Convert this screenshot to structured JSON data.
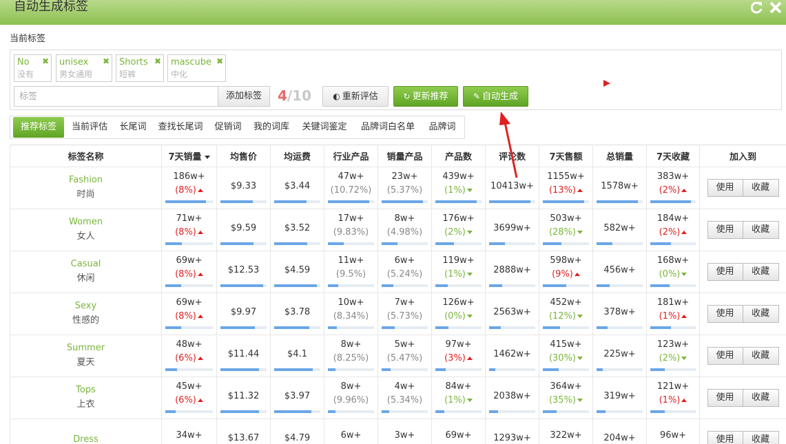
{
  "window": {
    "title": "自动生成标签",
    "icons": [
      "refresh-icon",
      "close-icon"
    ]
  },
  "current_tags_label": "当前标签",
  "current_tags": [
    {
      "en": "No",
      "zh": "没有"
    },
    {
      "en": "unisex",
      "zh": "男女通用"
    },
    {
      "en": "Shorts",
      "zh": "短裤"
    },
    {
      "en": "mascube",
      "zh": "中化"
    }
  ],
  "input": {
    "placeholder": "标签",
    "value": ""
  },
  "add_button": "添加标签",
  "counter": {
    "current": "4",
    "sep": "/",
    "max": "10"
  },
  "buttons": {
    "reassess": {
      "label": "重新评估",
      "icon": "gauge-icon"
    },
    "refresh_recommend": {
      "label": "更新推荐",
      "icon": "refresh-icon"
    },
    "auto_generate": {
      "label": "自动生成",
      "icon": "wand-icon"
    }
  },
  "tabs": [
    "推荐标签",
    "当前评估",
    "长尾词",
    "查找长尾词",
    "促销词",
    "我的词库",
    "关键词鉴定",
    "品牌词白名单",
    "品牌词"
  ],
  "active_tab": 0,
  "columns": [
    "标签名称",
    "7天销量",
    "均售价",
    "均运费",
    "行业产品",
    "销量产品",
    "产品数",
    "评论数",
    "7天售额",
    "总销量",
    "7天收藏",
    "加入到"
  ],
  "sorted_column": 1,
  "actions": {
    "use": "使用",
    "favorite": "收藏"
  },
  "colors": {
    "brand_green": "#7ab53a",
    "up_red": "#e02020",
    "bar_blue": "#6aa6e8",
    "arrow_red": "#e12020"
  },
  "rows": [
    {
      "en": "Fashion",
      "zh": "时尚",
      "sales7": {
        "v": "186w+",
        "sub": "(8%)",
        "dir": "up",
        "p": 0.85
      },
      "price": {
        "v": "$9.33",
        "p": 0.7
      },
      "ship": {
        "v": "$3.44",
        "p": 0.7
      },
      "industry": {
        "v": "47w+",
        "sub": "(10.72%)",
        "dir": "none",
        "p": 0.9
      },
      "sold": {
        "v": "23w+",
        "sub": "(5.37%)",
        "dir": "none",
        "p": 0.9
      },
      "products": {
        "v": "439w+",
        "sub": "(1%)",
        "dir": "down",
        "p": 0.9
      },
      "reviews": {
        "v": "10413w+",
        "p": 0.9
      },
      "rev7": {
        "v": "1155w+",
        "sub": "(13%)",
        "dir": "up",
        "p": 0.9
      },
      "total": {
        "v": "1578w+",
        "p": 0.9
      },
      "fav7": {
        "v": "383w+",
        "sub": "(2%)",
        "dir": "up",
        "p": 0.9
      }
    },
    {
      "en": "Women",
      "zh": "女人",
      "sales7": {
        "v": "71w+",
        "sub": "(8%)",
        "dir": "up",
        "p": 0.35
      },
      "price": {
        "v": "$9.59",
        "p": 0.72
      },
      "ship": {
        "v": "$3.52",
        "p": 0.72
      },
      "industry": {
        "v": "17w+",
        "sub": "(9.83%)",
        "dir": "none",
        "p": 0.35
      },
      "sold": {
        "v": "8w+",
        "sub": "(4.98%)",
        "dir": "none",
        "p": 0.35
      },
      "products": {
        "v": "176w+",
        "sub": "(2%)",
        "dir": "down",
        "p": 0.4
      },
      "reviews": {
        "v": "3699w+",
        "p": 0.35
      },
      "rev7": {
        "v": "503w+",
        "sub": "(28%)",
        "dir": "down",
        "p": 0.4
      },
      "total": {
        "v": "582w+",
        "p": 0.35
      },
      "fav7": {
        "v": "184w+",
        "sub": "(2%)",
        "dir": "up",
        "p": 0.45
      }
    },
    {
      "en": "Casual",
      "zh": "休闲",
      "sales7": {
        "v": "69w+",
        "sub": "(8%)",
        "dir": "up",
        "p": 0.33
      },
      "price": {
        "v": "$12.53",
        "p": 0.92
      },
      "ship": {
        "v": "$4.59",
        "p": 0.92
      },
      "industry": {
        "v": "11w+",
        "sub": "(9.5%)",
        "dir": "none",
        "p": 0.22
      },
      "sold": {
        "v": "6w+",
        "sub": "(5.24%)",
        "dir": "none",
        "p": 0.25
      },
      "products": {
        "v": "119w+",
        "sub": "(1%)",
        "dir": "down",
        "p": 0.27
      },
      "reviews": {
        "v": "2888w+",
        "p": 0.28
      },
      "rev7": {
        "v": "598w+",
        "sub": "(9%)",
        "dir": "up",
        "p": 0.5
      },
      "total": {
        "v": "456w+",
        "p": 0.28
      },
      "fav7": {
        "v": "168w+",
        "sub": "(0%)",
        "dir": "down",
        "p": 0.42
      }
    },
    {
      "en": "Sexy",
      "zh": "性感的",
      "sales7": {
        "v": "69w+",
        "sub": "(8%)",
        "dir": "up",
        "p": 0.33
      },
      "price": {
        "v": "$9.97",
        "p": 0.74
      },
      "ship": {
        "v": "$3.78",
        "p": 0.76
      },
      "industry": {
        "v": "10w+",
        "sub": "(8.34%)",
        "dir": "none",
        "p": 0.2
      },
      "sold": {
        "v": "7w+",
        "sub": "(5.73%)",
        "dir": "none",
        "p": 0.28
      },
      "products": {
        "v": "126w+",
        "sub": "(0%)",
        "dir": "down",
        "p": 0.28
      },
      "reviews": {
        "v": "2563w+",
        "p": 0.25
      },
      "rev7": {
        "v": "452w+",
        "sub": "(12%)",
        "dir": "down",
        "p": 0.38
      },
      "total": {
        "v": "378w+",
        "p": 0.24
      },
      "fav7": {
        "v": "181w+",
        "sub": "(1%)",
        "dir": "up",
        "p": 0.45
      }
    },
    {
      "en": "Summer",
      "zh": "夏天",
      "sales7": {
        "v": "48w+",
        "sub": "(6%)",
        "dir": "up",
        "p": 0.24
      },
      "price": {
        "v": "$11.44",
        "p": 0.84
      },
      "ship": {
        "v": "$4.1",
        "p": 0.84
      },
      "industry": {
        "v": "8w+",
        "sub": "(8.25%)",
        "dir": "none",
        "p": 0.16
      },
      "sold": {
        "v": "5w+",
        "sub": "(5.47%)",
        "dir": "none",
        "p": 0.2
      },
      "products": {
        "v": "97w+",
        "sub": "(3%)",
        "dir": "up",
        "p": 0.22
      },
      "reviews": {
        "v": "1462w+",
        "p": 0.14
      },
      "rev7": {
        "v": "415w+",
        "sub": "(30%)",
        "dir": "down",
        "p": 0.34
      },
      "total": {
        "v": "225w+",
        "p": 0.14
      },
      "fav7": {
        "v": "123w+",
        "sub": "(2%)",
        "dir": "down",
        "p": 0.32
      }
    },
    {
      "en": "Tops",
      "zh": "上衣",
      "sales7": {
        "v": "45w+",
        "sub": "(6%)",
        "dir": "up",
        "p": 0.22
      },
      "price": {
        "v": "$11.32",
        "p": 0.84
      },
      "ship": {
        "v": "$3.97",
        "p": 0.8
      },
      "industry": {
        "v": "8w+",
        "sub": "(9.96%)",
        "dir": "none",
        "p": 0.16
      },
      "sold": {
        "v": "4w+",
        "sub": "(5.34%)",
        "dir": "none",
        "p": 0.16
      },
      "products": {
        "v": "84w+",
        "sub": "(1%)",
        "dir": "down",
        "p": 0.19
      },
      "reviews": {
        "v": "2038w+",
        "p": 0.2
      },
      "rev7": {
        "v": "364w+",
        "sub": "(35%)",
        "dir": "down",
        "p": 0.3
      },
      "total": {
        "v": "319w+",
        "p": 0.2
      },
      "fav7": {
        "v": "121w+",
        "sub": "(1%)",
        "dir": "up",
        "p": 0.32
      }
    },
    {
      "en": "Dress",
      "zh": "",
      "sales7": {
        "v": "34w+",
        "sub": "",
        "dir": "up",
        "p": 0.18
      },
      "price": {
        "v": "$13.67",
        "p": 0.95
      },
      "ship": {
        "v": "$4.79",
        "p": 0.95
      },
      "industry": {
        "v": "6w+",
        "sub": "",
        "dir": "none",
        "p": 0.12
      },
      "sold": {
        "v": "3w+",
        "sub": "",
        "dir": "none",
        "p": 0.12
      },
      "products": {
        "v": "69w+",
        "sub": "",
        "dir": "down",
        "p": 0.16
      },
      "reviews": {
        "v": "1293w+",
        "p": 0.12
      },
      "rev7": {
        "v": "322w+",
        "sub": "",
        "dir": "down",
        "p": 0.26
      },
      "total": {
        "v": "204w+",
        "p": 0.12
      },
      "fav7": {
        "v": "96w+",
        "sub": "",
        "dir": "up",
        "p": 0.24
      }
    }
  ]
}
